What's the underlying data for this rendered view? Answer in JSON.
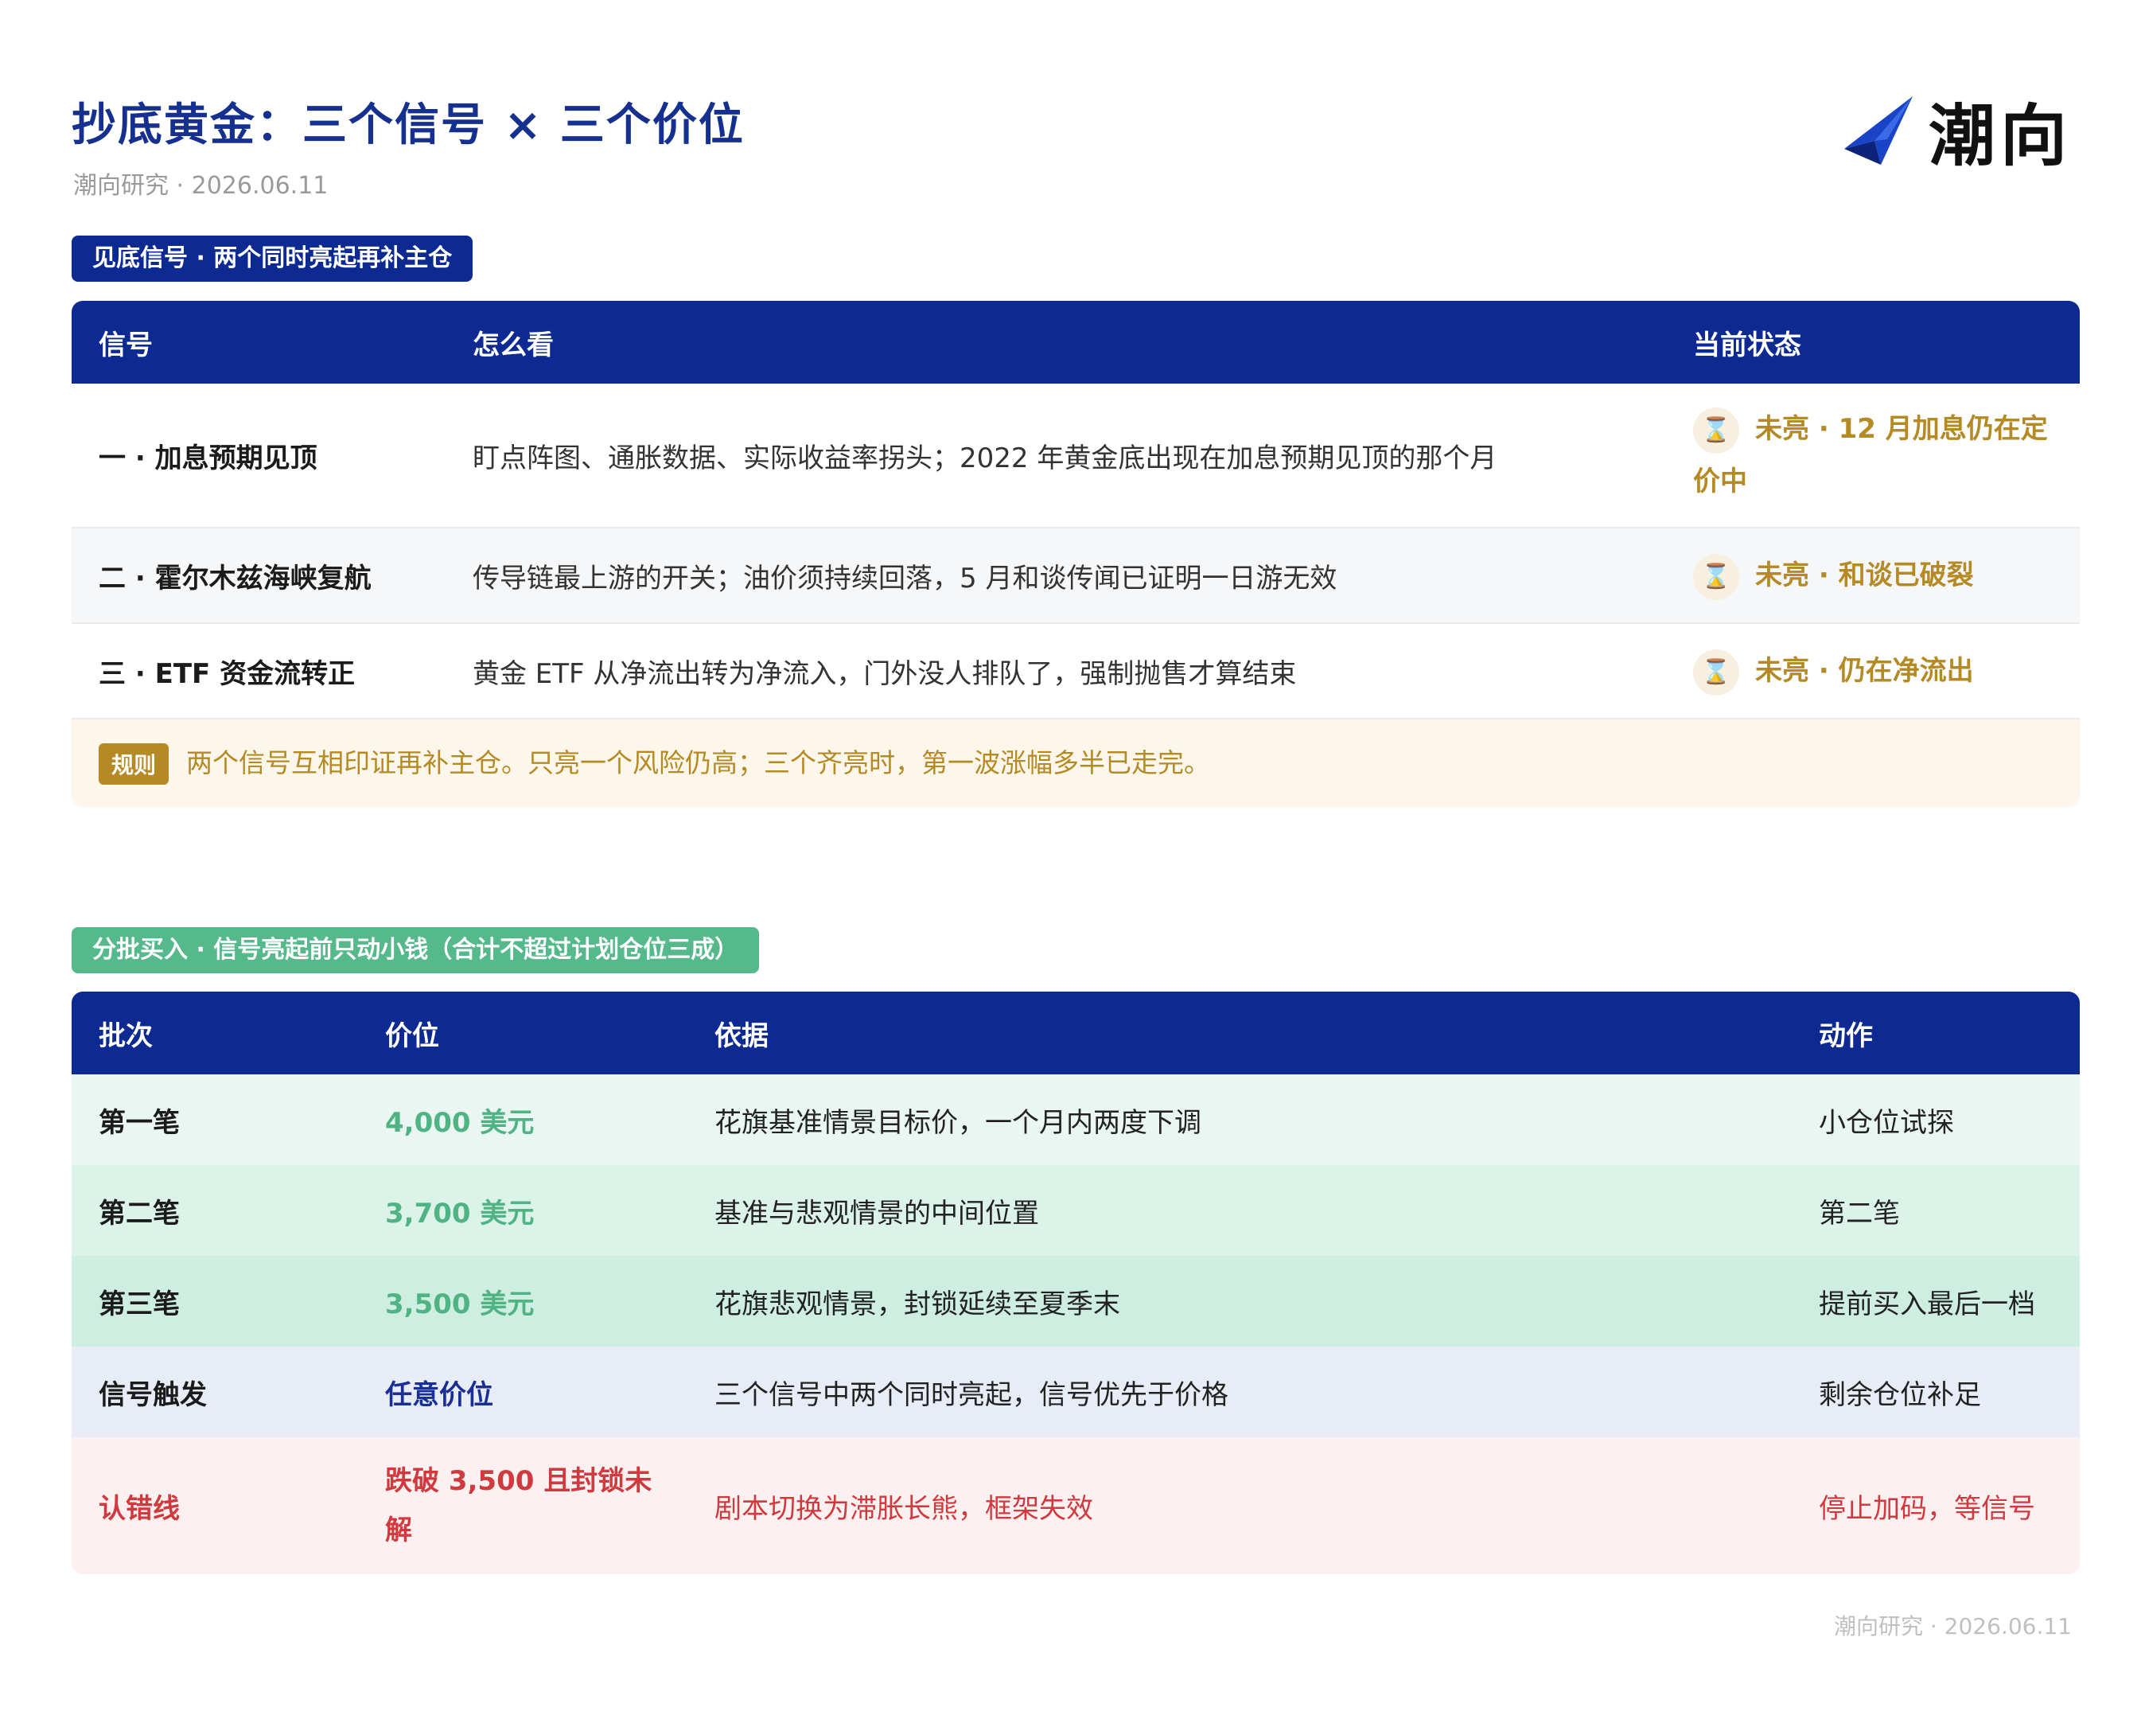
{
  "header": {
    "title": "抄底黄金：三个信号 × 三个价位",
    "subtitle": "潮向研究 · 2026.06.11",
    "brand": "潮向"
  },
  "section1": {
    "tag": "见底信号 · 两个同时亮起再补主仓",
    "columns": [
      "信号",
      "怎么看",
      "当前状态"
    ],
    "rows": [
      {
        "name": "一 · 加息预期见顶",
        "how": "盯点阵图、通胀数据、实际收益率拐头；2022 年黄金底出现在加息预期见顶的那个月",
        "status": "未亮 · 12 月加息仍在定价中"
      },
      {
        "name": "二 · 霍尔木兹海峡复航",
        "how": "传导链最上游的开关；油价须持续回落，5 月和谈传闻已证明一日游无效",
        "status": "未亮 · 和谈已破裂"
      },
      {
        "name": "三 · ETF 资金流转正",
        "how": "黄金 ETF 从净流出转为净流入，门外没人排队了，强制抛售才算结束",
        "status": "未亮 · 仍在净流出"
      }
    ],
    "rule_label": "规则",
    "rule_text": "两个信号互相印证再补主仓。只亮一个风险仍高；三个齐亮时，第一波涨幅多半已走完。",
    "status_icon": "hourglass-icon",
    "status_color": "#b58a25"
  },
  "section2": {
    "tag": "分批买入 · 信号亮起前只动小钱（合计不超过计划仓位三成）",
    "columns": [
      "批次",
      "价位",
      "依据",
      "动作"
    ],
    "rows": [
      {
        "batch": "第一笔",
        "price": "4,000 美元",
        "basis": "花旗基准情景目标价，一个月内两度下调",
        "action": "小仓位试探"
      },
      {
        "batch": "第二笔",
        "price": "3,700 美元",
        "basis": "基准与悲观情景的中间位置",
        "action": "第二笔"
      },
      {
        "batch": "第三笔",
        "price": "3,500 美元",
        "basis": "花旗悲观情景，封锁延续至夏季末",
        "action": "提前买入最后一档"
      },
      {
        "batch": "信号触发",
        "price": "任意价位",
        "basis": "三个信号中两个同时亮起，信号优先于价格",
        "action": "剩余仓位补足"
      },
      {
        "batch": "认错线",
        "price": "跌破 3,500 且封锁未解",
        "basis": "剧本切换为滞胀长熊，框架失效",
        "action": "停止加码，等信号"
      }
    ]
  },
  "footer": {
    "text": "潮向研究 · 2026.06.11"
  },
  "colors": {
    "navy": "#0c2a91",
    "green": "#55b98c",
    "gold": "#b58a25",
    "red": "#d0393e"
  }
}
